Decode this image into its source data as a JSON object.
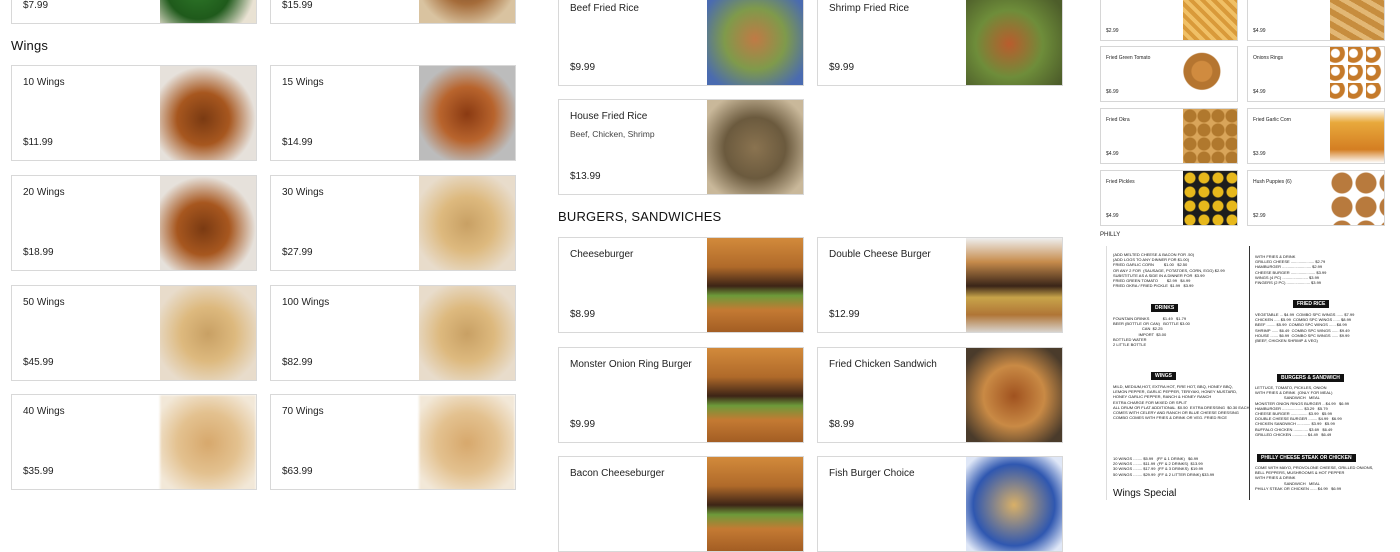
{
  "column1": {
    "top_items": [
      {
        "price": "$7.99"
      },
      {
        "price": "$15.99"
      }
    ],
    "section_title": "Wings",
    "items": [
      {
        "name": "10 Wings",
        "price": "$11.99"
      },
      {
        "name": "15 Wings",
        "price": "$14.99"
      },
      {
        "name": "20 Wings",
        "price": "$18.99"
      },
      {
        "name": "30 Wings",
        "price": "$27.99"
      },
      {
        "name": "50 Wings",
        "price": "$45.99"
      },
      {
        "name": "100 Wings",
        "price": "$82.99"
      },
      {
        "name": "40 Wings",
        "price": "$35.99"
      },
      {
        "name": "70 Wings",
        "price": "$63.99"
      }
    ]
  },
  "column2": {
    "rice_items": [
      {
        "name": "Beef Fried Rice",
        "price": "$9.99"
      },
      {
        "name": "Shrimp Fried Rice",
        "price": "$9.99"
      },
      {
        "name": "House Fried Rice",
        "desc": "Beef, Chicken, Shrimp",
        "price": "$13.99"
      }
    ],
    "section_title": "BURGERS, SANDWICHES",
    "burger_items": [
      {
        "name": "Cheeseburger",
        "price": "$8.99"
      },
      {
        "name": "Double Cheese Burger",
        "price": "$12.99"
      },
      {
        "name": "Monster Onion Ring Burger",
        "price": "$9.99"
      },
      {
        "name": "Fried Chicken Sandwich",
        "price": "$8.99"
      },
      {
        "name": "Bacon Cheeseburger",
        "price": ""
      },
      {
        "name": "Fish Burger Choice",
        "price": ""
      }
    ]
  },
  "column3": {
    "sides": [
      {
        "name": "",
        "price": "$2.99"
      },
      {
        "name": "",
        "price": "$4.99"
      },
      {
        "name": "Fried Green Tomato",
        "price": "$6.99"
      },
      {
        "name": "Onions Rings",
        "price": "$4.99"
      },
      {
        "name": "Fried Okra",
        "price": "$4.99"
      },
      {
        "name": "Fried Garlic Corn",
        "price": "$3.99"
      },
      {
        "name": "Fried Pickles",
        "price": "$4.99"
      },
      {
        "name": "Hush Puppies (6)",
        "price": "$2.99"
      }
    ],
    "section_label": "PHILLY",
    "menu_image": {
      "left_lines": "(ADD MELTED CHEESE & BACON FOR .50)\n(ADD LOGS TO ANY DINNER FOR $1.00)\nFRIED GARLIC CORN         $1.00   $2.50\nOR ANY 2 FOR  (SAUSAGE, POTATOES, CORN, EGG) $2.99\nSUBSTITUTE AS A SIDE IN A DINNER FOR  $3.99\nFRIED GREEN TOMATO        $2.99   $4.99\nFRIED OKRA / FRIED PICKLE  $1.99   $3.99",
      "drinks_bar": "DRINKS",
      "drinks_lines": "FOUNTAIN DRINKS            $1.49   $1.79\nBEER (BOTTLE OR CAN)   BOTTLE $3.00\n                          CAN  $2.25\n                       IMPORT  $3.00\nBOTTLED WATER\n2 LITTLE BOTTLE",
      "wings_bar": "WINGS",
      "wings_lines": "MILD, MEDIUM,HOT, EXTRA HOT, FIRE HOT, BBQ, HONEY BBQ,\nLEMON PEPPER, GARLIC PEPPER, TERIYAKI, HONEY MUSTARD,\nHONEY GARLIC PEPPER, RANCH & HONEY RANCH\nEXTRA CHARGE FOR MIXED OR SPLIT\nALL DRUM OR FLAT ADDITIONAL  $0.50  EXTRA DRESSING  $0.30 EACH\nCOMES WITH CELERY AND RANCH OR BLUE CHEESE DRESSING\nCOMBO COMES WITH FRIES & DRINK OR VEG. FRIED RICE",
      "combo_lines": "10 WINGS ........ $5.99   (FF & 1 DRINK)   $6.99\n20 WINGS ........ $11.99  (FF & 2 DRINKS)  $13.99\n30 WINGS ........ $17.99  (FF & 3 DRINKS)  $19.99\n50 WINGS ........ $29.99  (FF & 2 LITTER DRINK) $33.99",
      "wings_special": "Wings Special",
      "right_lines": "WITH FRIES & DRINK\nGRILLED CHEESE ..................... $2.79\nHAMBURGER .......................... $2.99\nCHEESE BURGER ...................... $3.99\nWINGS (4 PC) ....................... $3.99\nFINGERS (2 PC) ..................... $3.99",
      "fried_rice_bar": "FRIED RICE",
      "fried_rice_lines": "VEGETABLE ... $4.99  COMBO SPC WINGS ...... $7.99\nCHICKEN ..... $5.99  COMBO SPC WINGS ...... $8.99\nBEEF ........ $5.99  COMBO SPC WINGS ...... $8.99\nSHRIMP ...... $6.49  COMBO SPC WINGS ...... $9.49\nHOUSE ....... $6.99  COMBO SPC WINGS ...... $9.99\n(BEEF, CHICKEN SHRIMP & VEG)",
      "burgers_bar": "BURGERS & SANDWICH",
      "burgers_lines": "LETTUCE, TOMATO, PICKLES, ONION\nWITH FRIES & DRINK  (ONLY FOR MEAL)\n                          SANDWICH   MEAL\nMONSTER ONION RINGS BURGER .. $4.99   $6.99\nHAMBURGER ................... $3.29   $5.79\nCHEESE BURGER ............... $3.99   $5.99\nDOUBLE CHEESE BURGER ........ $4.99   $6.99\nCHICKEN SANDWICH ............ $3.99   $5.99\nBUFFALO CHICKEN ............. $3.69   $6.49\nGRILLED CHICKEN ............. $4.49   $6.49",
      "philly_bar": "PHILLY CHEESE STEAK OR CHICKEN",
      "philly_lines": "COME WITH MAYO, PROVOLONE CHEESE, GRILLED ONIONS,\nBELL PEPPERS, MUSHROOMS & HOT PEPPER\nWITH FRIES & DRINK\n                          SANDWICH   MEAL\nPHILLY STEAK OR CHICKEN ...... $4.99   $6.99"
    }
  }
}
